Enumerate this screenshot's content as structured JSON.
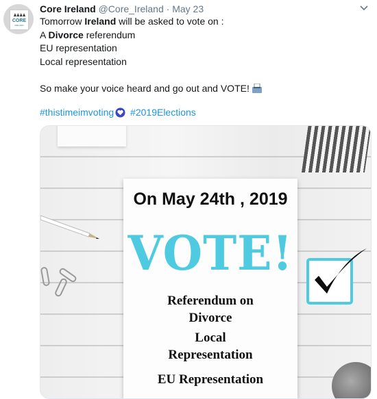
{
  "tweet": {
    "author_name": "Core Ireland",
    "handle": "@Core_Ireland",
    "separator": "·",
    "date": "May 23",
    "avatar": {
      "name": "CORE",
      "sub": "IRELAND",
      "people": "♟♟♟♟"
    },
    "lines": {
      "l1_a": "Tomorrow ",
      "l1_b": "Ireland",
      "l1_c": " will be asked to vote on :",
      "l2_a": "A ",
      "l2_b": "Divorce",
      "l2_c": " referendum",
      "l3": "EU representation",
      "l4": "Local representation",
      "l5": "So make your voice heard and go out and VOTE!"
    },
    "hashtags": [
      "#thistimeimvoting",
      "#2019Elections"
    ],
    "icons": {
      "ballot": "ballot-box-icon",
      "heart": "blue-heart-icon",
      "caret": "chevron-down-icon"
    }
  },
  "poster": {
    "date": "On May 24th , 2019",
    "headline": "VOTE!",
    "item1_l1": "Referendum on",
    "item1_l2": "Divorce",
    "item2_l1": "Local",
    "item2_l2": "Representation",
    "item3": "EU Representation"
  },
  "colors": {
    "link": "#1b95e0",
    "muted": "#657786",
    "vote": "#4ecbe0",
    "check_box": "#4ecbe0"
  }
}
